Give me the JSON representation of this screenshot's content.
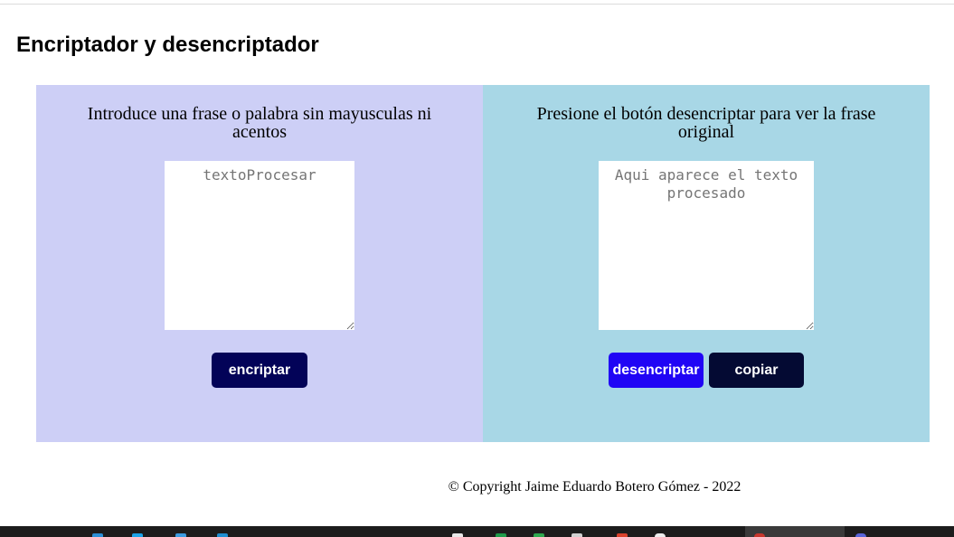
{
  "page": {
    "title": "Encriptador y desencriptador"
  },
  "encrypt_panel": {
    "instruction": "Introduce una frase o palabra sin mayusculas ni acentos",
    "textarea_placeholder": "textoProcesar",
    "textarea_value": "",
    "encrypt_button_label": "encriptar",
    "background_color": "#cdcff6"
  },
  "decrypt_panel": {
    "instruction": "Presione el botón desencriptar para ver la frase original",
    "textarea_placeholder": "Aqui aparece el texto procesado",
    "textarea_value": "",
    "decrypt_button_label": "desencriptar",
    "copy_button_label": "copiar",
    "background_color": "#a8d7e6"
  },
  "footer": {
    "text": "© Copyright Jaime Eduardo Botero Gómez - 2022"
  },
  "colors": {
    "encrypt_button": "#030358",
    "decrypt_button": "#2005f5",
    "copy_button": "#040a33"
  }
}
